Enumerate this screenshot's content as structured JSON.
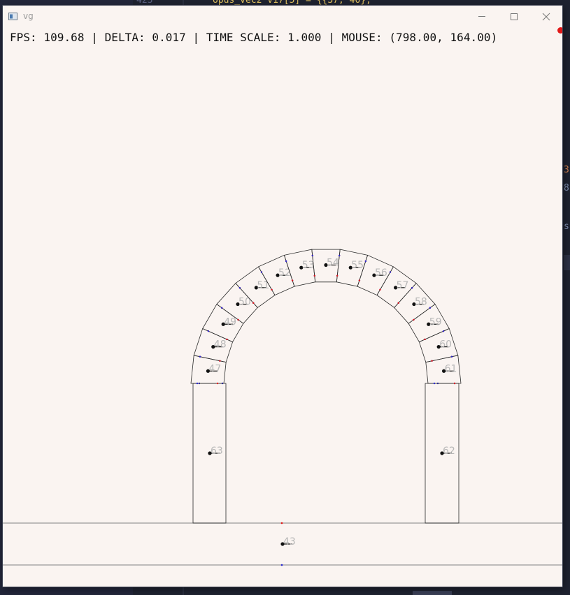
{
  "window": {
    "title": "vg",
    "controls": {
      "minimize": "minimize-icon",
      "maximize": "maximize-icon",
      "close": "close-icon"
    }
  },
  "hud": {
    "fps_label": "FPS:",
    "fps": "109.68",
    "delta_label": "DELTA:",
    "delta": "0.017",
    "time_scale_label": "TIME SCALE:",
    "time_scale": "1.000",
    "mouse_label": "MOUSE:",
    "mouse": "(798.00, 164.00)",
    "separator": "|"
  },
  "colors": {
    "window_bg": "#faf4f1",
    "outline": "#2a2a2a",
    "ground_line": "#999999",
    "label": "#b8b8b8",
    "marker_red": "#e21818",
    "marker_blue": "#2a2ad0",
    "backdrop": "#1e2230"
  },
  "scene": {
    "ground_label": "43",
    "arch_block_labels": [
      "47",
      "48",
      "49",
      "50",
      "51",
      "52",
      "53",
      "54",
      "55",
      "56",
      "57",
      "58",
      "59",
      "60",
      "61"
    ],
    "left_pillar_label": "63",
    "right_pillar_label": "62"
  }
}
